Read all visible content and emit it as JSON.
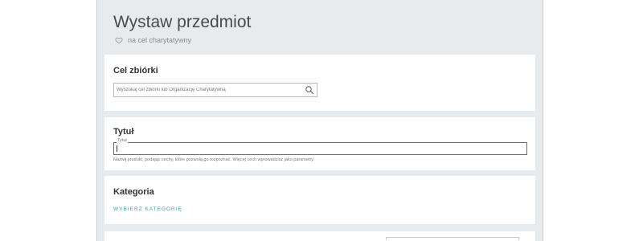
{
  "header": {
    "title": "Wystaw przedmiot",
    "subtitle": "na cel charytatywny",
    "subtitle_icon": "heart-outline-icon"
  },
  "sections": {
    "charity": {
      "heading": "Cel zbiórki",
      "search_placeholder": "Wyszukaj cel zbiórki lub Organizację Charytatywną",
      "search_icon": "search-icon"
    },
    "title": {
      "heading": "Tytuł",
      "field_label": "Tytuł",
      "field_value": "",
      "helper": "Nazwij produkt, podając cechy, które pozwolą go rozpoznać. Więcej cech wprowadzisz jako parametry."
    },
    "category": {
      "heading": "Kategoria",
      "link": "WYBIERZ KATEGORIĘ"
    }
  },
  "colors": {
    "panel_bg": "#e8ebee",
    "card_bg": "#ffffff",
    "accent": "#3ba89a"
  }
}
